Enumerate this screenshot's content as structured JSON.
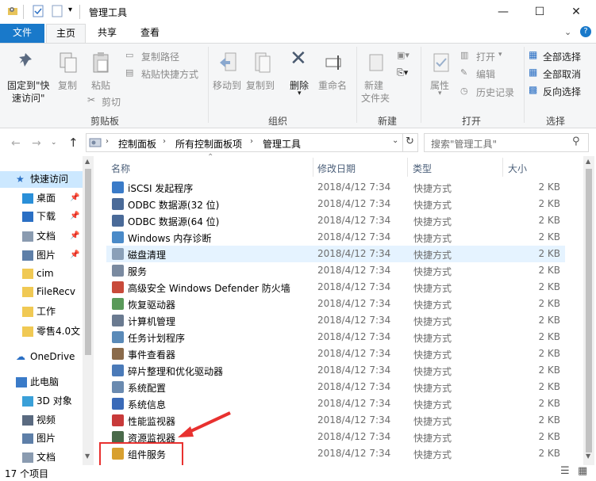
{
  "window": {
    "title": "管理工具",
    "controls": {
      "minimize": "—",
      "maximize": "☐",
      "close": "✕"
    }
  },
  "tabs": {
    "file": "文件",
    "home": "主页",
    "share": "共享",
    "view": "查看"
  },
  "ribbon": {
    "pin_quick_access": "固定到\"快速访问\"",
    "pin_line1": "固定到\"快",
    "pin_line2": "速访问\"",
    "copy": "复制",
    "paste": "粘贴",
    "copy_path": "复制路径",
    "paste_shortcut": "粘贴快捷方式",
    "cut": "剪切",
    "group_clipboard": "剪贴板",
    "move_to": "移动到",
    "copy_to": "复制到",
    "delete": "删除",
    "rename": "重命名",
    "group_organize": "组织",
    "new_folder_l1": "新建",
    "new_folder_l2": "文件夹",
    "group_new": "新建",
    "properties": "属性",
    "open": "打开",
    "edit": "编辑",
    "history": "历史记录",
    "group_open": "打开",
    "select_all": "全部选择",
    "select_none": "全部取消",
    "invert_selection": "反向选择",
    "group_select": "选择"
  },
  "address": {
    "crumbs": [
      "控制面板",
      "所有控制面板项",
      "管理工具"
    ],
    "search_placeholder": "搜索\"管理工具\""
  },
  "nav": [
    {
      "label": "快速访问",
      "icon": "star-icon",
      "pinned": false
    },
    {
      "label": "桌面",
      "icon": "desktop-icon",
      "pinned": true
    },
    {
      "label": "下载",
      "icon": "download-icon",
      "pinned": true
    },
    {
      "label": "文档",
      "icon": "document-icon",
      "pinned": true
    },
    {
      "label": "图片",
      "icon": "picture-icon",
      "pinned": true
    },
    {
      "label": "cim",
      "icon": "folder-icon",
      "pinned": false
    },
    {
      "label": "FileRecv",
      "icon": "folder-icon",
      "pinned": false
    },
    {
      "label": "工作",
      "icon": "folder-icon",
      "pinned": false
    },
    {
      "label": "零售4.0文",
      "icon": "folder-check-icon",
      "pinned": false
    },
    {
      "label": "OneDrive",
      "icon": "cloud-icon",
      "pinned": false
    },
    {
      "label": "此电脑",
      "icon": "computer-icon",
      "pinned": false
    },
    {
      "label": "3D 对象",
      "icon": "3d-objects-icon",
      "pinned": false
    },
    {
      "label": "视频",
      "icon": "video-icon",
      "pinned": false
    },
    {
      "label": "图片",
      "icon": "picture-icon",
      "pinned": false
    },
    {
      "label": "文档",
      "icon": "document-icon",
      "pinned": false
    }
  ],
  "columns": {
    "name": "名称",
    "date": "修改日期",
    "type": "类型",
    "size": "大小"
  },
  "files": [
    {
      "name": "iSCSI 发起程序",
      "date": "2018/4/12 7:34",
      "type": "快捷方式",
      "size": "2 KB"
    },
    {
      "name": "ODBC 数据源(32 位)",
      "date": "2018/4/12 7:34",
      "type": "快捷方式",
      "size": "2 KB"
    },
    {
      "name": "ODBC 数据源(64 位)",
      "date": "2018/4/12 7:34",
      "type": "快捷方式",
      "size": "2 KB"
    },
    {
      "name": "Windows 内存诊断",
      "date": "2018/4/12 7:34",
      "type": "快捷方式",
      "size": "2 KB"
    },
    {
      "name": "磁盘清理",
      "date": "2018/4/12 7:34",
      "type": "快捷方式",
      "size": "2 KB"
    },
    {
      "name": "服务",
      "date": "2018/4/12 7:34",
      "type": "快捷方式",
      "size": "2 KB"
    },
    {
      "name": "高级安全 Windows Defender 防火墙",
      "date": "2018/4/12 7:34",
      "type": "快捷方式",
      "size": "2 KB"
    },
    {
      "name": "恢复驱动器",
      "date": "2018/4/12 7:34",
      "type": "快捷方式",
      "size": "2 KB"
    },
    {
      "name": "计算机管理",
      "date": "2018/4/12 7:34",
      "type": "快捷方式",
      "size": "2 KB"
    },
    {
      "name": "任务计划程序",
      "date": "2018/4/12 7:34",
      "type": "快捷方式",
      "size": "2 KB"
    },
    {
      "name": "事件查看器",
      "date": "2018/4/12 7:34",
      "type": "快捷方式",
      "size": "2 KB"
    },
    {
      "name": "碎片整理和优化驱动器",
      "date": "2018/4/12 7:34",
      "type": "快捷方式",
      "size": "2 KB"
    },
    {
      "name": "系统配置",
      "date": "2018/4/12 7:34",
      "type": "快捷方式",
      "size": "2 KB"
    },
    {
      "name": "系统信息",
      "date": "2018/4/12 7:34",
      "type": "快捷方式",
      "size": "2 KB"
    },
    {
      "name": "性能监视器",
      "date": "2018/4/12 7:34",
      "type": "快捷方式",
      "size": "2 KB"
    },
    {
      "name": "资源监视器",
      "date": "2018/4/12 7:34",
      "type": "快捷方式",
      "size": "2 KB"
    },
    {
      "name": "组件服务",
      "date": "2018/4/12 7:34",
      "type": "快捷方式",
      "size": "2 KB"
    }
  ],
  "status": {
    "count": "17 个项目"
  },
  "colors": {
    "accent": "#1979ca",
    "highlight": "#e5f3ff",
    "annotation_red": "#e8312f"
  }
}
